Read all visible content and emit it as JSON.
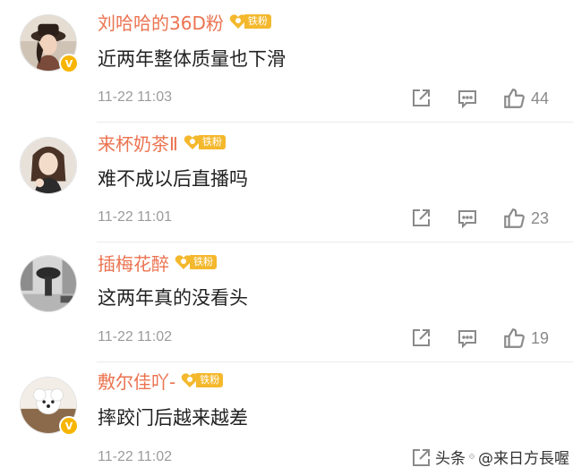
{
  "comments": [
    {
      "username": "刘哈哈的36D粉",
      "fan_badge": "铁粉",
      "text": "近两年整体质量也下滑",
      "timestamp": "11-22 11:03",
      "likes": "44",
      "verified": true,
      "avatar": "avatar-girl-hat"
    },
    {
      "username": "来杯奶茶Ⅱ",
      "fan_badge": "铁粉",
      "text": "难不成以后直播吗",
      "timestamp": "11-22 11:01",
      "likes": "23",
      "verified": false,
      "avatar": "avatar-girl"
    },
    {
      "username": "插梅花醉",
      "fan_badge": "铁粉",
      "text": "这两年真的没看头",
      "timestamp": "11-22 11:02",
      "likes": "19",
      "verified": false,
      "avatar": "avatar-street-umbrella"
    },
    {
      "username": "敷尔佳吖-",
      "fan_badge": "铁粉",
      "text": "摔跤门后越来越差",
      "timestamp": "11-22 11:02",
      "likes": "",
      "verified": true,
      "avatar": "avatar-white-dog"
    }
  ],
  "watermark": {
    "prefix": "头条",
    "handle": "@来日方長喔"
  },
  "colors": {
    "username": "#eb7350",
    "badge": "#f4b82d",
    "verified": "#f7b500",
    "meta": "#9b9b9b"
  },
  "icons": {
    "share": "share-icon",
    "comment": "comment-icon",
    "like": "thumbs-up-icon"
  }
}
